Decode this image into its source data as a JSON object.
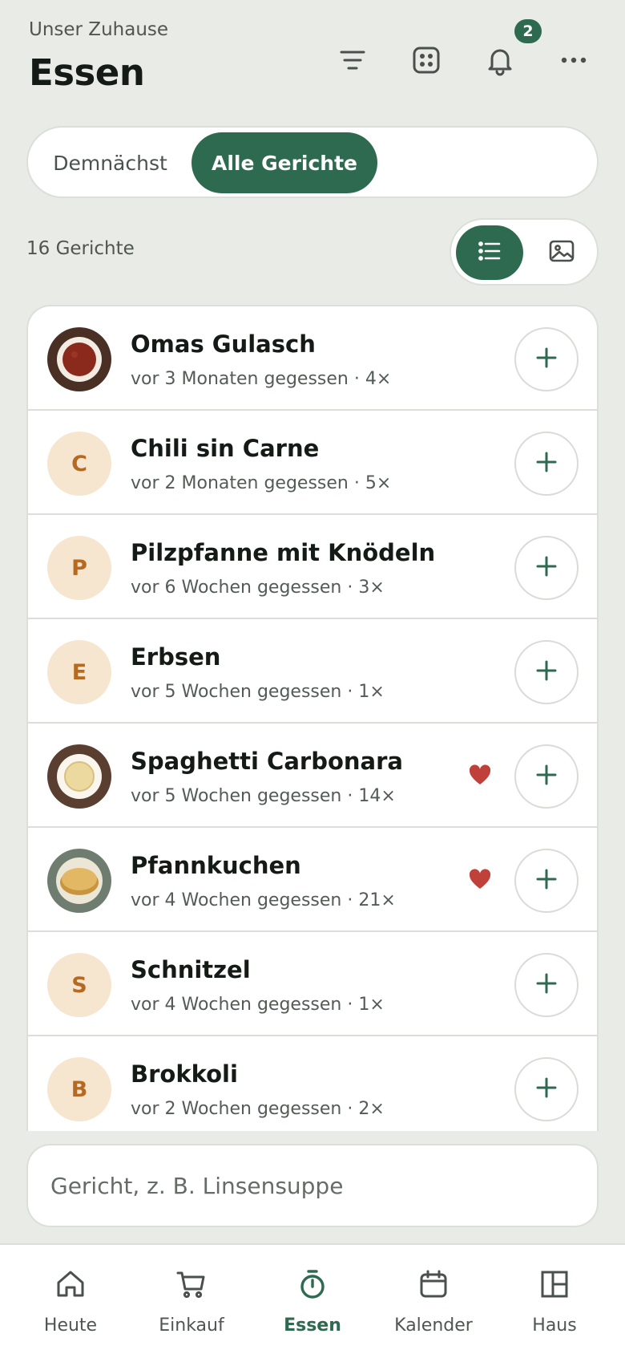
{
  "header": {
    "subtitle": "Unser Zuhause",
    "title": "Essen",
    "notification_count": "2",
    "icons": [
      "filter-icon",
      "grid-icon",
      "bell-icon",
      "more-icon"
    ]
  },
  "tabs": [
    {
      "label": "Demnächst",
      "active": false
    },
    {
      "label": "Alle Gerichte",
      "active": true
    }
  ],
  "count_label": "16 Gerichte",
  "view_toggle": {
    "active": "list",
    "options": [
      "list-icon",
      "image-icon"
    ]
  },
  "meals": [
    {
      "name": "Omas Gulasch",
      "meta": "vor 3 Monaten gegessen · 4×",
      "avatar": "image",
      "favorite": false
    },
    {
      "name": "Chili sin Carne",
      "meta": "vor 2 Monaten gegessen · 5×",
      "avatar": "C",
      "favorite": false
    },
    {
      "name": "Pilzpfanne mit Knödeln",
      "meta": "vor 6 Wochen gegessen · 3×",
      "avatar": "P",
      "favorite": false
    },
    {
      "name": "Erbsen",
      "meta": "vor 5 Wochen gegessen · 1×",
      "avatar": "E",
      "favorite": false
    },
    {
      "name": "Spaghetti Carbonara",
      "meta": "vor 5 Wochen gegessen · 14×",
      "avatar": "image",
      "favorite": true
    },
    {
      "name": "Pfannkuchen",
      "meta": "vor 4 Wochen gegessen · 21×",
      "avatar": "image",
      "favorite": true
    },
    {
      "name": "Schnitzel",
      "meta": "vor 4 Wochen gegessen · 1×",
      "avatar": "S",
      "favorite": false
    },
    {
      "name": "Brokkoli",
      "meta": "vor 2 Wochen gegessen · 2×",
      "avatar": "B",
      "favorite": false
    }
  ],
  "search": {
    "placeholder": "Gericht, z. B. Linsensuppe"
  },
  "nav": [
    {
      "label": "Heute",
      "icon": "home-icon",
      "active": false
    },
    {
      "label": "Einkauf",
      "icon": "cart-icon",
      "active": false
    },
    {
      "label": "Essen",
      "icon": "timer-icon",
      "active": true
    },
    {
      "label": "Kalender",
      "icon": "calendar-icon",
      "active": false
    },
    {
      "label": "Haus",
      "icon": "layout-icon",
      "active": false
    }
  ],
  "colors": {
    "accent": "#2e6a4f",
    "background": "#e9ebe6",
    "avatar_letter_bg": "#f6e5cf",
    "avatar_letter_fg": "#b56a22",
    "heart": "#c0403a"
  }
}
